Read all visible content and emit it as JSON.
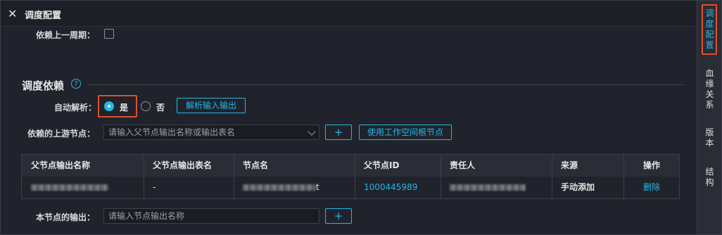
{
  "title": "调度配置",
  "right_rail": [
    {
      "label": [
        "调",
        "度",
        "配",
        "置"
      ],
      "active": true
    },
    {
      "label": [
        "血",
        "缘",
        "关",
        "系"
      ],
      "active": false
    },
    {
      "label": [
        "版",
        "本"
      ],
      "active": false
    },
    {
      "label": [
        "结",
        "构"
      ],
      "active": false
    }
  ],
  "depend_prev_cycle": {
    "label": "依赖上一周期：",
    "checked": false
  },
  "section": {
    "title": "调度依赖"
  },
  "auto_parse": {
    "label": "自动解析：",
    "options": [
      "是",
      "否"
    ],
    "selected": "是",
    "parse_button": "解析输入输出"
  },
  "upstream": {
    "label": "依赖的上游节点：",
    "placeholder": "请输入父节点输出名称或输出表名",
    "add_button": "+",
    "root_button": "使用工作空间根节点"
  },
  "table": {
    "headers": [
      "父节点输出名称",
      "父节点输出表名",
      "节点名",
      "父节点ID",
      "责任人",
      "来源",
      "操作"
    ],
    "rows": [
      {
        "output_name": "",
        "output_table": "-",
        "node_name": "t",
        "node_id": "1000445989",
        "owner": "",
        "source": "手动添加",
        "action": "删除"
      }
    ]
  },
  "node_output": {
    "label": "本节点的输出：",
    "placeholder": "请输入节点输出名称",
    "add_button": "+"
  },
  "colors": {
    "accent": "#22b8e6",
    "highlight": "#e0502d",
    "background": "#20232b"
  }
}
